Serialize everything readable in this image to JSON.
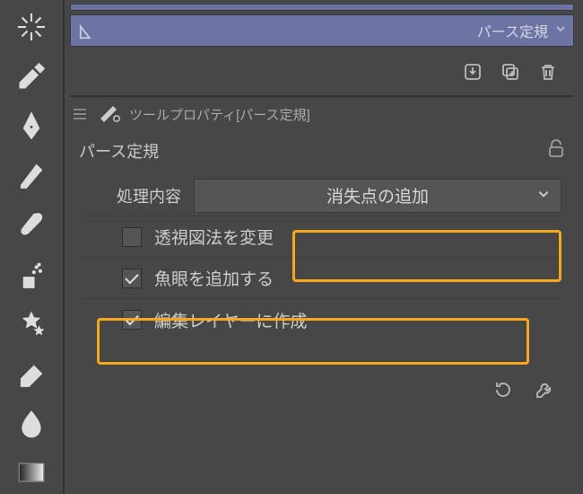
{
  "subtool": {
    "label": "パース定規"
  },
  "panel": {
    "header": "ツールプロパティ[パース定規]",
    "title": "パース定規"
  },
  "settings": {
    "processLabel": "処理内容",
    "processValue": "消失点の追加",
    "changePerspective": {
      "label": "透視図法を変更",
      "checked": false
    },
    "addFisheye": {
      "label": "魚眼を追加する",
      "checked": true
    },
    "createOnEdit": {
      "label": "編集レイヤーに作成",
      "checked": true
    }
  }
}
